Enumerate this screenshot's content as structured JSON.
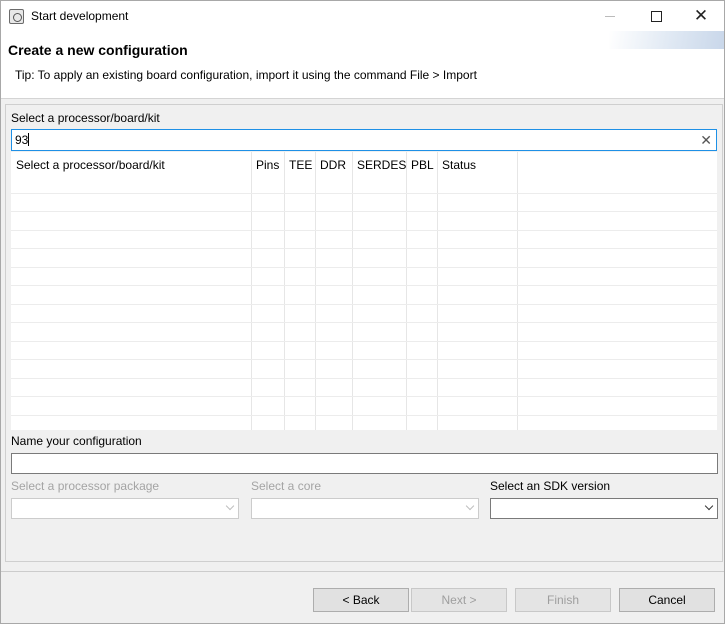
{
  "window": {
    "title": "Start development"
  },
  "header": {
    "title": "Create a new configuration",
    "tip": "Tip: To apply an existing board configuration, import it using the command File > Import"
  },
  "processor": {
    "label": "Select a processor/board/kit",
    "search_value": "93",
    "clear_icon": "close-icon"
  },
  "table": {
    "columns": [
      "Select a processor/board/kit",
      "Pins",
      "TEE",
      "DDR",
      "SERDES",
      "PBL",
      "Status"
    ],
    "rows": []
  },
  "name_section": {
    "label": "Name your configuration",
    "value": ""
  },
  "package": {
    "label": "Select a processor package",
    "value": ""
  },
  "core": {
    "label": "Select a core",
    "value": ""
  },
  "sdk": {
    "label": "Select an SDK version",
    "value": ""
  },
  "buttons": {
    "back": "< Back",
    "next": "Next >",
    "finish": "Finish",
    "cancel": "Cancel"
  },
  "colors": {
    "focus_border": "#1e90e6",
    "disabled_text": "#a4a4a4"
  }
}
